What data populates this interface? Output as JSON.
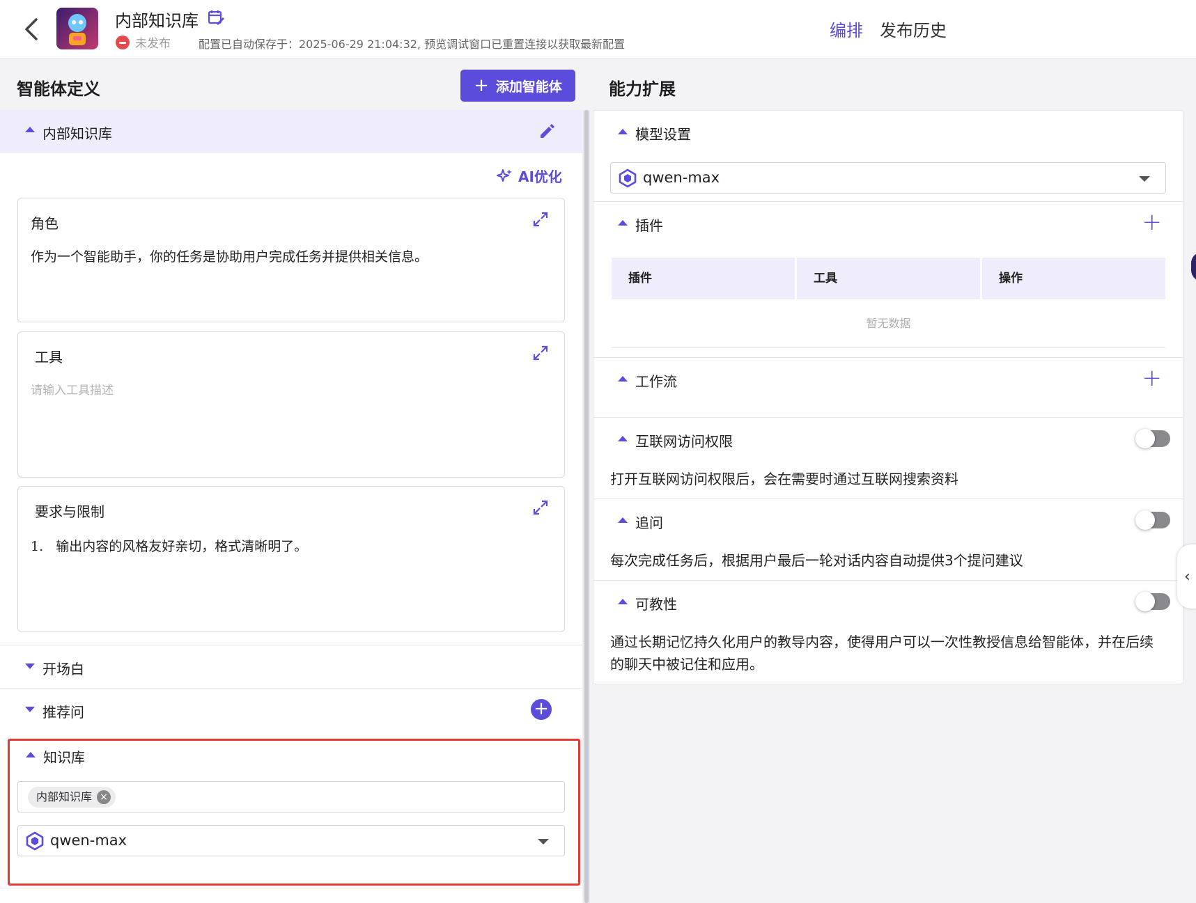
{
  "header": {
    "title": "内部知识库",
    "status": "未发布",
    "saved_note": "配置已自动保存于：2025-06-29 21:04:32, 预览调试窗口已重置连接以获取最新配置",
    "tabs": {
      "edit": "编排",
      "history": "发布历史"
    }
  },
  "left": {
    "heading": "智能体定义",
    "add_agent_label": "添加智能体",
    "agent_name": "内部知识库",
    "ai_optimize": "AI优化",
    "role": {
      "title": "角色",
      "text": "作为一个智能助手，你的任务是协助用户完成任务并提供相关信息。"
    },
    "tools": {
      "title": "工具",
      "placeholder": "请输入工具描述"
    },
    "requirements": {
      "title": "要求与限制",
      "items": [
        "1.   输出内容的风格友好亲切，格式清晰明了。"
      ]
    },
    "opening": "开场白",
    "recommend": "推荐问",
    "knowledge": {
      "title": "知识库",
      "chip": "内部知识库",
      "model": "qwen-max"
    }
  },
  "right": {
    "heading": "能力扩展",
    "model": {
      "title": "模型设置",
      "value": "qwen-max"
    },
    "plugins": {
      "title": "插件",
      "columns": [
        "插件",
        "工具",
        "操作"
      ],
      "empty": "暂无数据"
    },
    "workflow": "工作流",
    "internet": {
      "title": "互联网访问权限",
      "desc": "打开互联网访问权限后，会在需要时通过互联网搜索资料"
    },
    "followup": {
      "title": "追问",
      "desc": "每次完成任务后，根据用户最后一轮对话内容自动提供3个提问建议"
    },
    "teachable": {
      "title": "可教性",
      "desc": "通过长期记忆持久化用户的教导内容，使得用户可以一次性教授信息给智能体，并在后续的聊天中被记住和应用。"
    }
  },
  "colors": {
    "accent": "#5b4cdb",
    "highlight_border": "#e53935",
    "status_red": "#e5484d"
  }
}
